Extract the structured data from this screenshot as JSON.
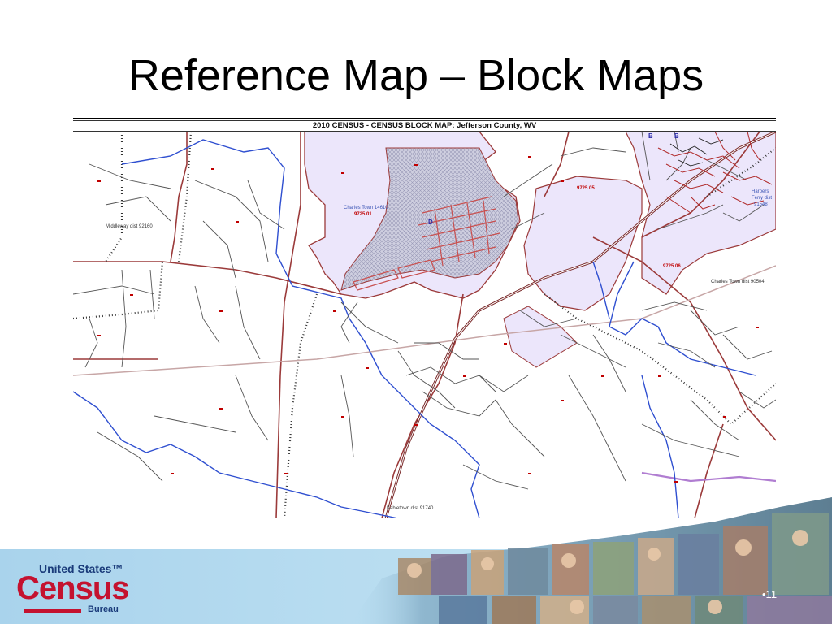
{
  "slide": {
    "title": "Reference Map – Block Maps",
    "page_number": "•11"
  },
  "map": {
    "header": "2010 CENSUS - CENSUS BLOCK MAP: Jefferson County, WV",
    "labels": {
      "middleway": "Middleway dist 92160",
      "charles_town_place": "Charles Town 14610",
      "tract_972501": "9725.01",
      "tract_972505": "9725.05",
      "tract_972506": "9725.06",
      "harpers_1": "Harpers",
      "harpers_2": "Ferry dist",
      "harpers_3": "91548",
      "charles_town_dist": "Charles Town dist 90504",
      "kabletown": "Kabletown dist 91740",
      "letter_b1": "B",
      "letter_b2": "B",
      "letter_d": "D"
    },
    "colors": {
      "place_fill": "#ece6fb",
      "hatch_fill": "#bdbdd6",
      "boundary": "#9b3a3a",
      "water": "#2f4fd0",
      "road": "#444444",
      "railroad": "#333333",
      "tract_text": "#c00000",
      "place_text": "#3b55b5",
      "county_line": "#b07dd1"
    }
  },
  "footer": {
    "logo_line1": "United States™",
    "logo_line2": "Census",
    "logo_line3": "Bureau"
  }
}
